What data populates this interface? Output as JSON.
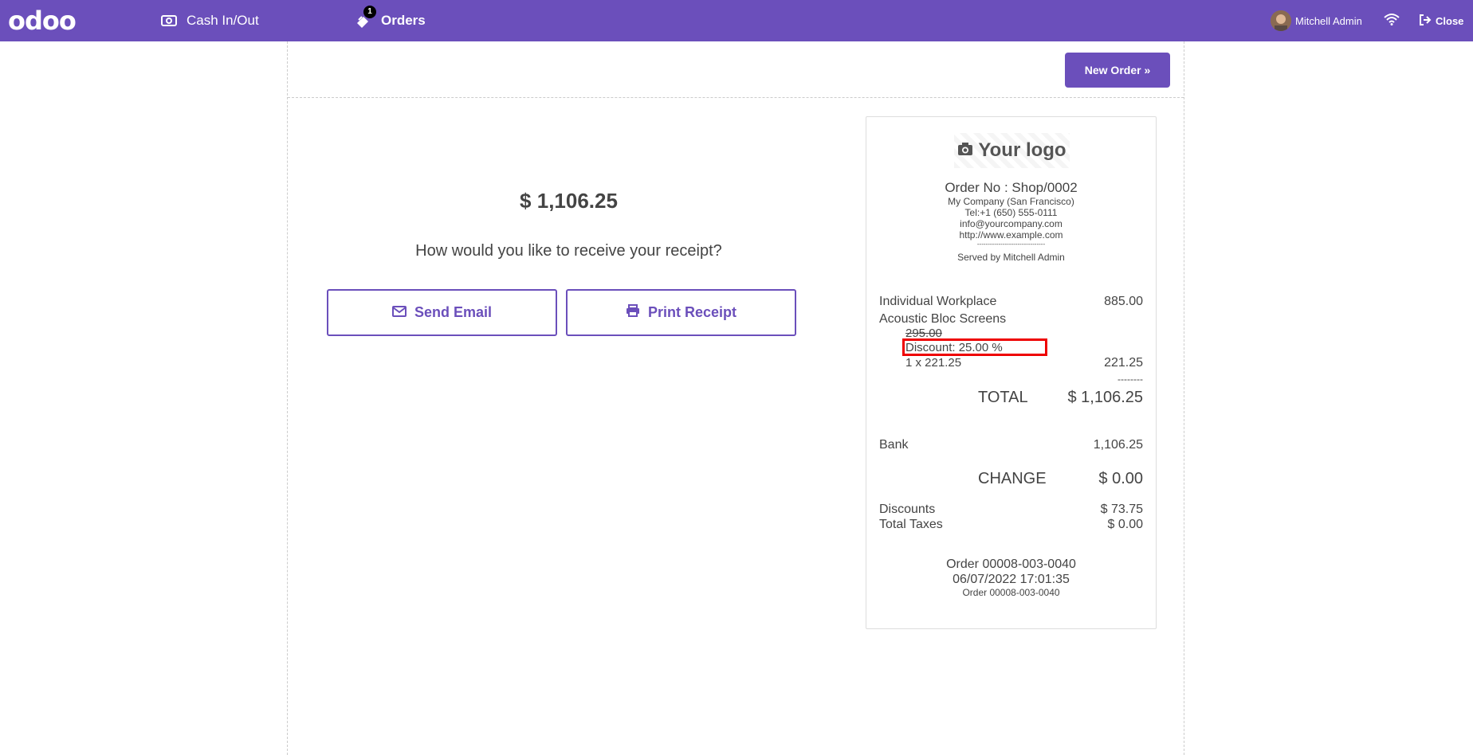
{
  "navbar": {
    "logo": "odoo",
    "cash_label": "Cash In/Out",
    "orders_label": "Orders",
    "orders_badge": "1",
    "user_name": "Mitchell Admin",
    "close_label": "Close",
    "brand_color": "#6b4fbb"
  },
  "main": {
    "new_order_label": "New Order »",
    "total": "$ 1,106.25",
    "question": "How would you like to receive your receipt?",
    "email_label": "Send Email",
    "print_label": "Print Receipt"
  },
  "receipt": {
    "logo_text": "Your logo",
    "order_no": "Order No : Shop/0002",
    "company": "My Company (San Francisco)",
    "tel": "Tel:+1 (650) 555-0111",
    "email": "info@yourcompany.com",
    "website": "http://www.example.com",
    "separator": "--------------------------------",
    "served_by": "Served by Mitchell Admin",
    "lines": [
      {
        "name": "Individual Workplace",
        "price": "885.00"
      },
      {
        "name": "Acoustic Bloc Screens",
        "orig_price": "295.00",
        "discount": "Discount: 25.00 %",
        "qty_line": "1 x 221.25",
        "price": "221.25"
      }
    ],
    "dashes": "--------",
    "total_label": "TOTAL",
    "total_value": "$ 1,106.25",
    "payment_method": "Bank",
    "payment_amount": "1,106.25",
    "change_label": "CHANGE",
    "change_value": "$ 0.00",
    "discounts_label": "Discounts",
    "discounts_value": "$ 73.75",
    "taxes_label": "Total Taxes",
    "taxes_value": "$ 0.00",
    "footer_order": "Order 00008-003-0040",
    "footer_date": "06/07/2022 17:01:35",
    "footer_order_small": "Order 00008-003-0040"
  },
  "icons": {
    "cash": "money-icon",
    "orders": "ticket-icon",
    "wifi": "wifi-icon",
    "close": "sign-out-icon",
    "email": "envelope-icon",
    "print": "printer-icon",
    "logo": "camera-icon"
  }
}
